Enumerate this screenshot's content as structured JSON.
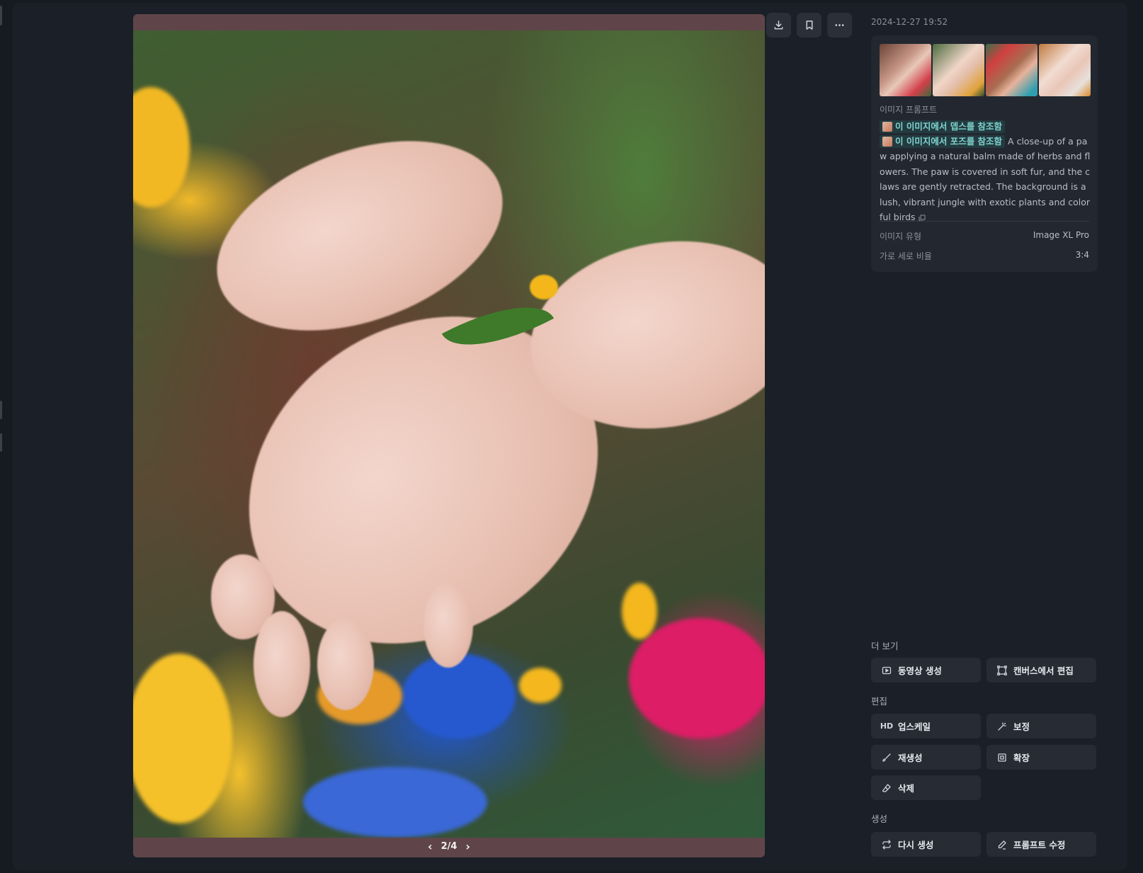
{
  "viewer": {
    "pager_text": "2/4",
    "current_page": 2,
    "total_pages": 4
  },
  "toolbar": {
    "download_icon": "download-icon",
    "bookmark_icon": "bookmark-icon",
    "more_icon": "more-horizontal-icon"
  },
  "info": {
    "timestamp": "2024-12-27 19:52",
    "prompt_label": "이미지 프롬프트",
    "ref_depth": "이 이미지에서 뎁스를 참조함",
    "ref_pose": "이 이미지에서 포즈를 참조함",
    "prompt_text": "A close-up of a paw applying a natural balm made of herbs and flowers. The paw is covered in soft fur, and the claws are gently retracted. The background is a lush, vibrant jungle with exotic plants and colorful birds",
    "type_label": "이미지 유형",
    "type_value": "Image XL Pro",
    "ratio_label": "가로 세로 비율",
    "ratio_value": "3:4"
  },
  "sections": {
    "more": "더 보기",
    "edit": "편집",
    "generate": "생성"
  },
  "buttons": {
    "video": "동영상 생성",
    "canvas": "캔버스에서 편집",
    "upscale_prefix": "HD",
    "upscale": "업스케일",
    "retouch": "보정",
    "regenerate": "재생성",
    "expand": "확장",
    "erase": "삭제",
    "redo": "다시 생성",
    "edit_prompt": "프롬프트 수정"
  }
}
